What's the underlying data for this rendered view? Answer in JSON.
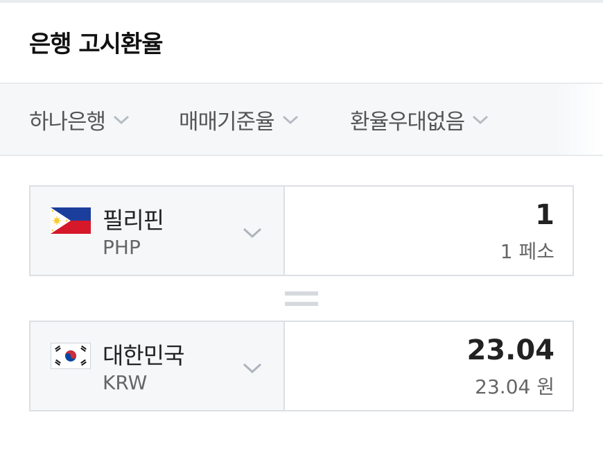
{
  "title": "은행 고시환율",
  "filters": [
    {
      "label": "하나은행"
    },
    {
      "label": "매매기준율"
    },
    {
      "label": "환율우대없음"
    }
  ],
  "from": {
    "currency_name": "필리핀",
    "currency_code": "PHP",
    "amount": "1",
    "amount_text": "1 페소",
    "flag_icon": "philippines-flag-icon"
  },
  "to": {
    "currency_name": "대한민국",
    "currency_code": "KRW",
    "amount": "23.04",
    "amount_text": "23.04 원",
    "flag_icon": "korea-flag-icon"
  },
  "colors": {
    "ph_blue": "#1B3E9C",
    "ph_red": "#D5182A",
    "ph_sun": "#F7CC2E",
    "kr_red": "#CD2E3A",
    "kr_blue": "#0047A0"
  }
}
